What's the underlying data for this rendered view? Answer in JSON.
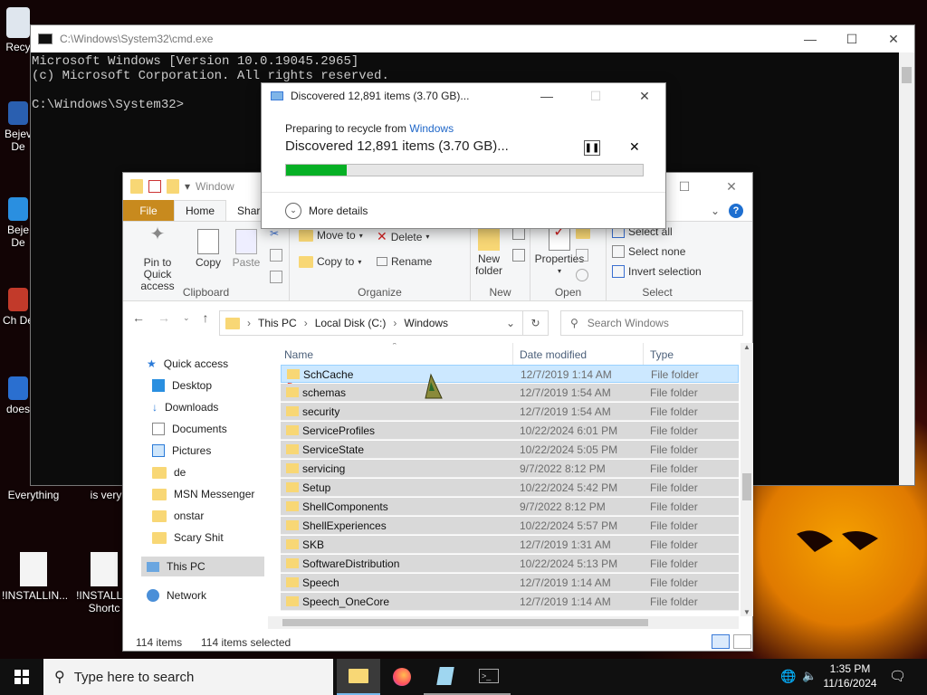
{
  "colors": {
    "accent": "#0078d7",
    "file_tab": "#c88a1e",
    "progress": "#06b025",
    "selection": "#cce8ff"
  },
  "desktop": {
    "icons": [
      {
        "label": "Recy",
        "icon": "recycle-bin-icon"
      },
      {
        "label": "Bejev De",
        "icon": "shortcut-icon"
      },
      {
        "label": "Beje De",
        "icon": "shortcut-icon"
      },
      {
        "label": "Ch De",
        "icon": "shortcut-icon"
      },
      {
        "label": "does",
        "icon": "shortcut-icon"
      },
      {
        "label": "Everything",
        "icon": "app-icon"
      },
      {
        "label": "is very",
        "icon": "shortcut-icon"
      },
      {
        "label": "!INSTALLIN...",
        "icon": "document-icon"
      },
      {
        "label": "!INSTALLI - Shortc",
        "icon": "document-icon"
      }
    ]
  },
  "cmd": {
    "title": "C:\\Windows\\System32\\cmd.exe",
    "lines": [
      "Microsoft Windows [Version 10.0.19045.2965]",
      "(c) Microsoft Corporation. All rights reserved.",
      "",
      "C:\\Windows\\System32>"
    ]
  },
  "dialog": {
    "title": "Discovered 12,891 items (3.70 GB)...",
    "subtitle_prefix": "Preparing to recycle from ",
    "subtitle_link": "Windows",
    "main": "Discovered 12,891 items (3.70 GB)...",
    "progress": 0.17,
    "more_details": "More details"
  },
  "explorer": {
    "title": "Window",
    "tabs": {
      "file": "File",
      "home": "Home",
      "share": "Shar"
    },
    "ribbon": {
      "clipboard": {
        "label": "Clipboard",
        "pin": "Pin to Quick access",
        "copy": "Copy",
        "paste": "Paste"
      },
      "organize": {
        "label": "Organize",
        "move_to": "Move to",
        "copy_to": "Copy to",
        "delete": "Delete",
        "rename": "Rename"
      },
      "new": {
        "label": "New",
        "new_folder": "New folder"
      },
      "open": {
        "label": "Open",
        "properties": "Properties"
      },
      "select": {
        "label": "Select",
        "select_all": "Select all",
        "select_none": "Select none",
        "invert": "Invert selection"
      }
    },
    "breadcrumb": [
      "This PC",
      "Local Disk (C:)",
      "Windows"
    ],
    "search_placeholder": "Search Windows",
    "nav": {
      "quick_access": "Quick access",
      "items": [
        {
          "label": "Desktop",
          "pinned": true
        },
        {
          "label": "Downloads",
          "pinned": true
        },
        {
          "label": "Documents",
          "pinned": true
        },
        {
          "label": "Pictures",
          "pinned": true
        },
        {
          "label": "de",
          "pinned": false
        },
        {
          "label": "MSN Messenger",
          "pinned": false
        },
        {
          "label": "onstar",
          "pinned": false
        },
        {
          "label": "Scary Shit",
          "pinned": false
        }
      ],
      "this_pc": "This PC",
      "network": "Network"
    },
    "columns": {
      "name": "Name",
      "date": "Date modified",
      "type": "Type"
    },
    "rows": [
      {
        "name": "SchCache",
        "date": "12/7/2019 1:14 AM",
        "type": "File folder"
      },
      {
        "name": "schemas",
        "date": "12/7/2019 1:54 AM",
        "type": "File folder"
      },
      {
        "name": "security",
        "date": "12/7/2019 1:54 AM",
        "type": "File folder"
      },
      {
        "name": "ServiceProfiles",
        "date": "10/22/2024 6:01 PM",
        "type": "File folder"
      },
      {
        "name": "ServiceState",
        "date": "10/22/2024 5:05 PM",
        "type": "File folder"
      },
      {
        "name": "servicing",
        "date": "9/7/2022 8:12 PM",
        "type": "File folder"
      },
      {
        "name": "Setup",
        "date": "10/22/2024 5:42 PM",
        "type": "File folder"
      },
      {
        "name": "ShellComponents",
        "date": "9/7/2022 8:12 PM",
        "type": "File folder"
      },
      {
        "name": "ShellExperiences",
        "date": "10/22/2024 5:57 PM",
        "type": "File folder"
      },
      {
        "name": "SKB",
        "date": "12/7/2019 1:31 AM",
        "type": "File folder"
      },
      {
        "name": "SoftwareDistribution",
        "date": "10/22/2024 5:13 PM",
        "type": "File folder"
      },
      {
        "name": "Speech",
        "date": "12/7/2019 1:14 AM",
        "type": "File folder"
      },
      {
        "name": "Speech_OneCore",
        "date": "12/7/2019 1:14 AM",
        "type": "File folder"
      }
    ],
    "status": {
      "items": "114 items",
      "selected": "114 items selected"
    }
  },
  "taskbar": {
    "search_placeholder": "Type here to search",
    "apps": [
      "file-explorer-icon",
      "firefox-icon",
      "notepad-icon",
      "cmd-icon"
    ],
    "time": "1:35 PM",
    "date": "11/16/2024"
  }
}
